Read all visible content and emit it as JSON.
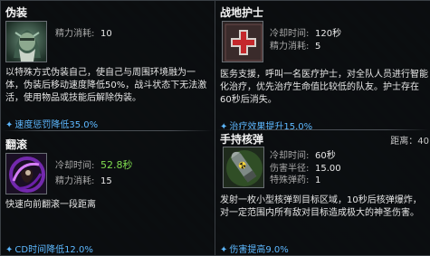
{
  "skills": [
    {
      "name": "伪装",
      "stats": [
        {
          "key": "精力消耗:",
          "value": "10"
        }
      ],
      "description": "以特殊方式伪装自己，使自己与周围环境融为一体，伪装后移动速度降低50%，战斗状态下无法激活，使用物品或技能后解除伪装。",
      "bonus": "速度惩罚降低35.0%",
      "icon": "camouflage-icon"
    },
    {
      "name": "翻滚",
      "stats": [
        {
          "key": "冷却时间:",
          "value": "52.8秒"
        },
        {
          "key": "精力消耗:",
          "value": "15"
        }
      ],
      "description": "快速向前翻滚一段距离",
      "bonus": "CD时间降低12.0%",
      "icon": "roll-icon"
    },
    {
      "name": "战地护士",
      "stats": [
        {
          "key": "冷却时间:",
          "value": "120秒"
        },
        {
          "key": "精力消耗:",
          "value": "5"
        }
      ],
      "description": "医务支援，呼叫一名医疗护士，对全队人员进行智能化治疗，优先治疗生命值比较低的队友。护士存在60秒后消失。",
      "bonus": "治疗效果提升15.0%",
      "icon": "medic-cross-icon"
    },
    {
      "name": "手持核弹",
      "range": "距离：40",
      "stats": [
        {
          "key": "冷却时间:",
          "value": "60秒"
        },
        {
          "key": "伤害半径:",
          "value": "15.00"
        },
        {
          "key": "特殊弹药:",
          "value": "1"
        }
      ],
      "description": "发射一枚小型核弹到目标区域，10秒后核弹爆炸，对一定范围内所有敌对目标造成极大的神圣伤害。",
      "bonus": "伤害提高9.0%",
      "icon": "nuke-shell-icon"
    }
  ],
  "colors": {
    "bonus": "#5db8ff",
    "value_highlight": "#7fdc4f"
  }
}
